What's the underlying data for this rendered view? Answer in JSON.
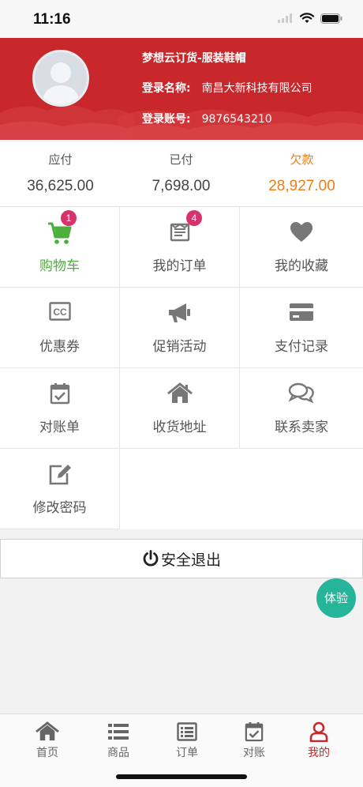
{
  "status_bar": {
    "time": "11:16"
  },
  "header": {
    "store_title": "梦想云订货-服装鞋帽",
    "name_label": "登录名称:",
    "name_value": "南昌大新科技有限公司",
    "account_label": "登录账号:",
    "account_value": "9876543210",
    "background_color": "#c8282c"
  },
  "summary": {
    "payable": {
      "label": "应付",
      "value": "36,625.00"
    },
    "paid": {
      "label": "已付",
      "value": "7,698.00"
    },
    "debt": {
      "label": "欠款",
      "value": "28,927.00",
      "color": "#ee7d16"
    }
  },
  "menu": [
    {
      "label": "购物车",
      "icon": "cart-icon",
      "badge": "1",
      "active": true
    },
    {
      "label": "我的订单",
      "icon": "order-list-icon",
      "badge": "4"
    },
    {
      "label": "我的收藏",
      "icon": "heart-icon"
    },
    {
      "label": "优惠券",
      "icon": "coupon-cc-icon"
    },
    {
      "label": "促销活动",
      "icon": "megaphone-icon"
    },
    {
      "label": "支付记录",
      "icon": "credit-card-icon"
    },
    {
      "label": "对账单",
      "icon": "calendar-check-icon"
    },
    {
      "label": "收货地址",
      "icon": "home-icon"
    },
    {
      "label": "联系卖家",
      "icon": "chat-icon"
    },
    {
      "label": "修改密码",
      "icon": "edit-icon"
    }
  ],
  "logout": {
    "label": "安全退出"
  },
  "trial_button": {
    "label": "体验",
    "color": "#26b59b"
  },
  "tabbar": {
    "tabs": [
      {
        "label": "首页",
        "icon": "home-icon"
      },
      {
        "label": "商品",
        "icon": "list-icon"
      },
      {
        "label": "订单",
        "icon": "order-icon"
      },
      {
        "label": "对账",
        "icon": "calendar-check-icon"
      },
      {
        "label": "我的",
        "icon": "user-icon",
        "active": true
      }
    ],
    "active_color": "#c8282c"
  }
}
